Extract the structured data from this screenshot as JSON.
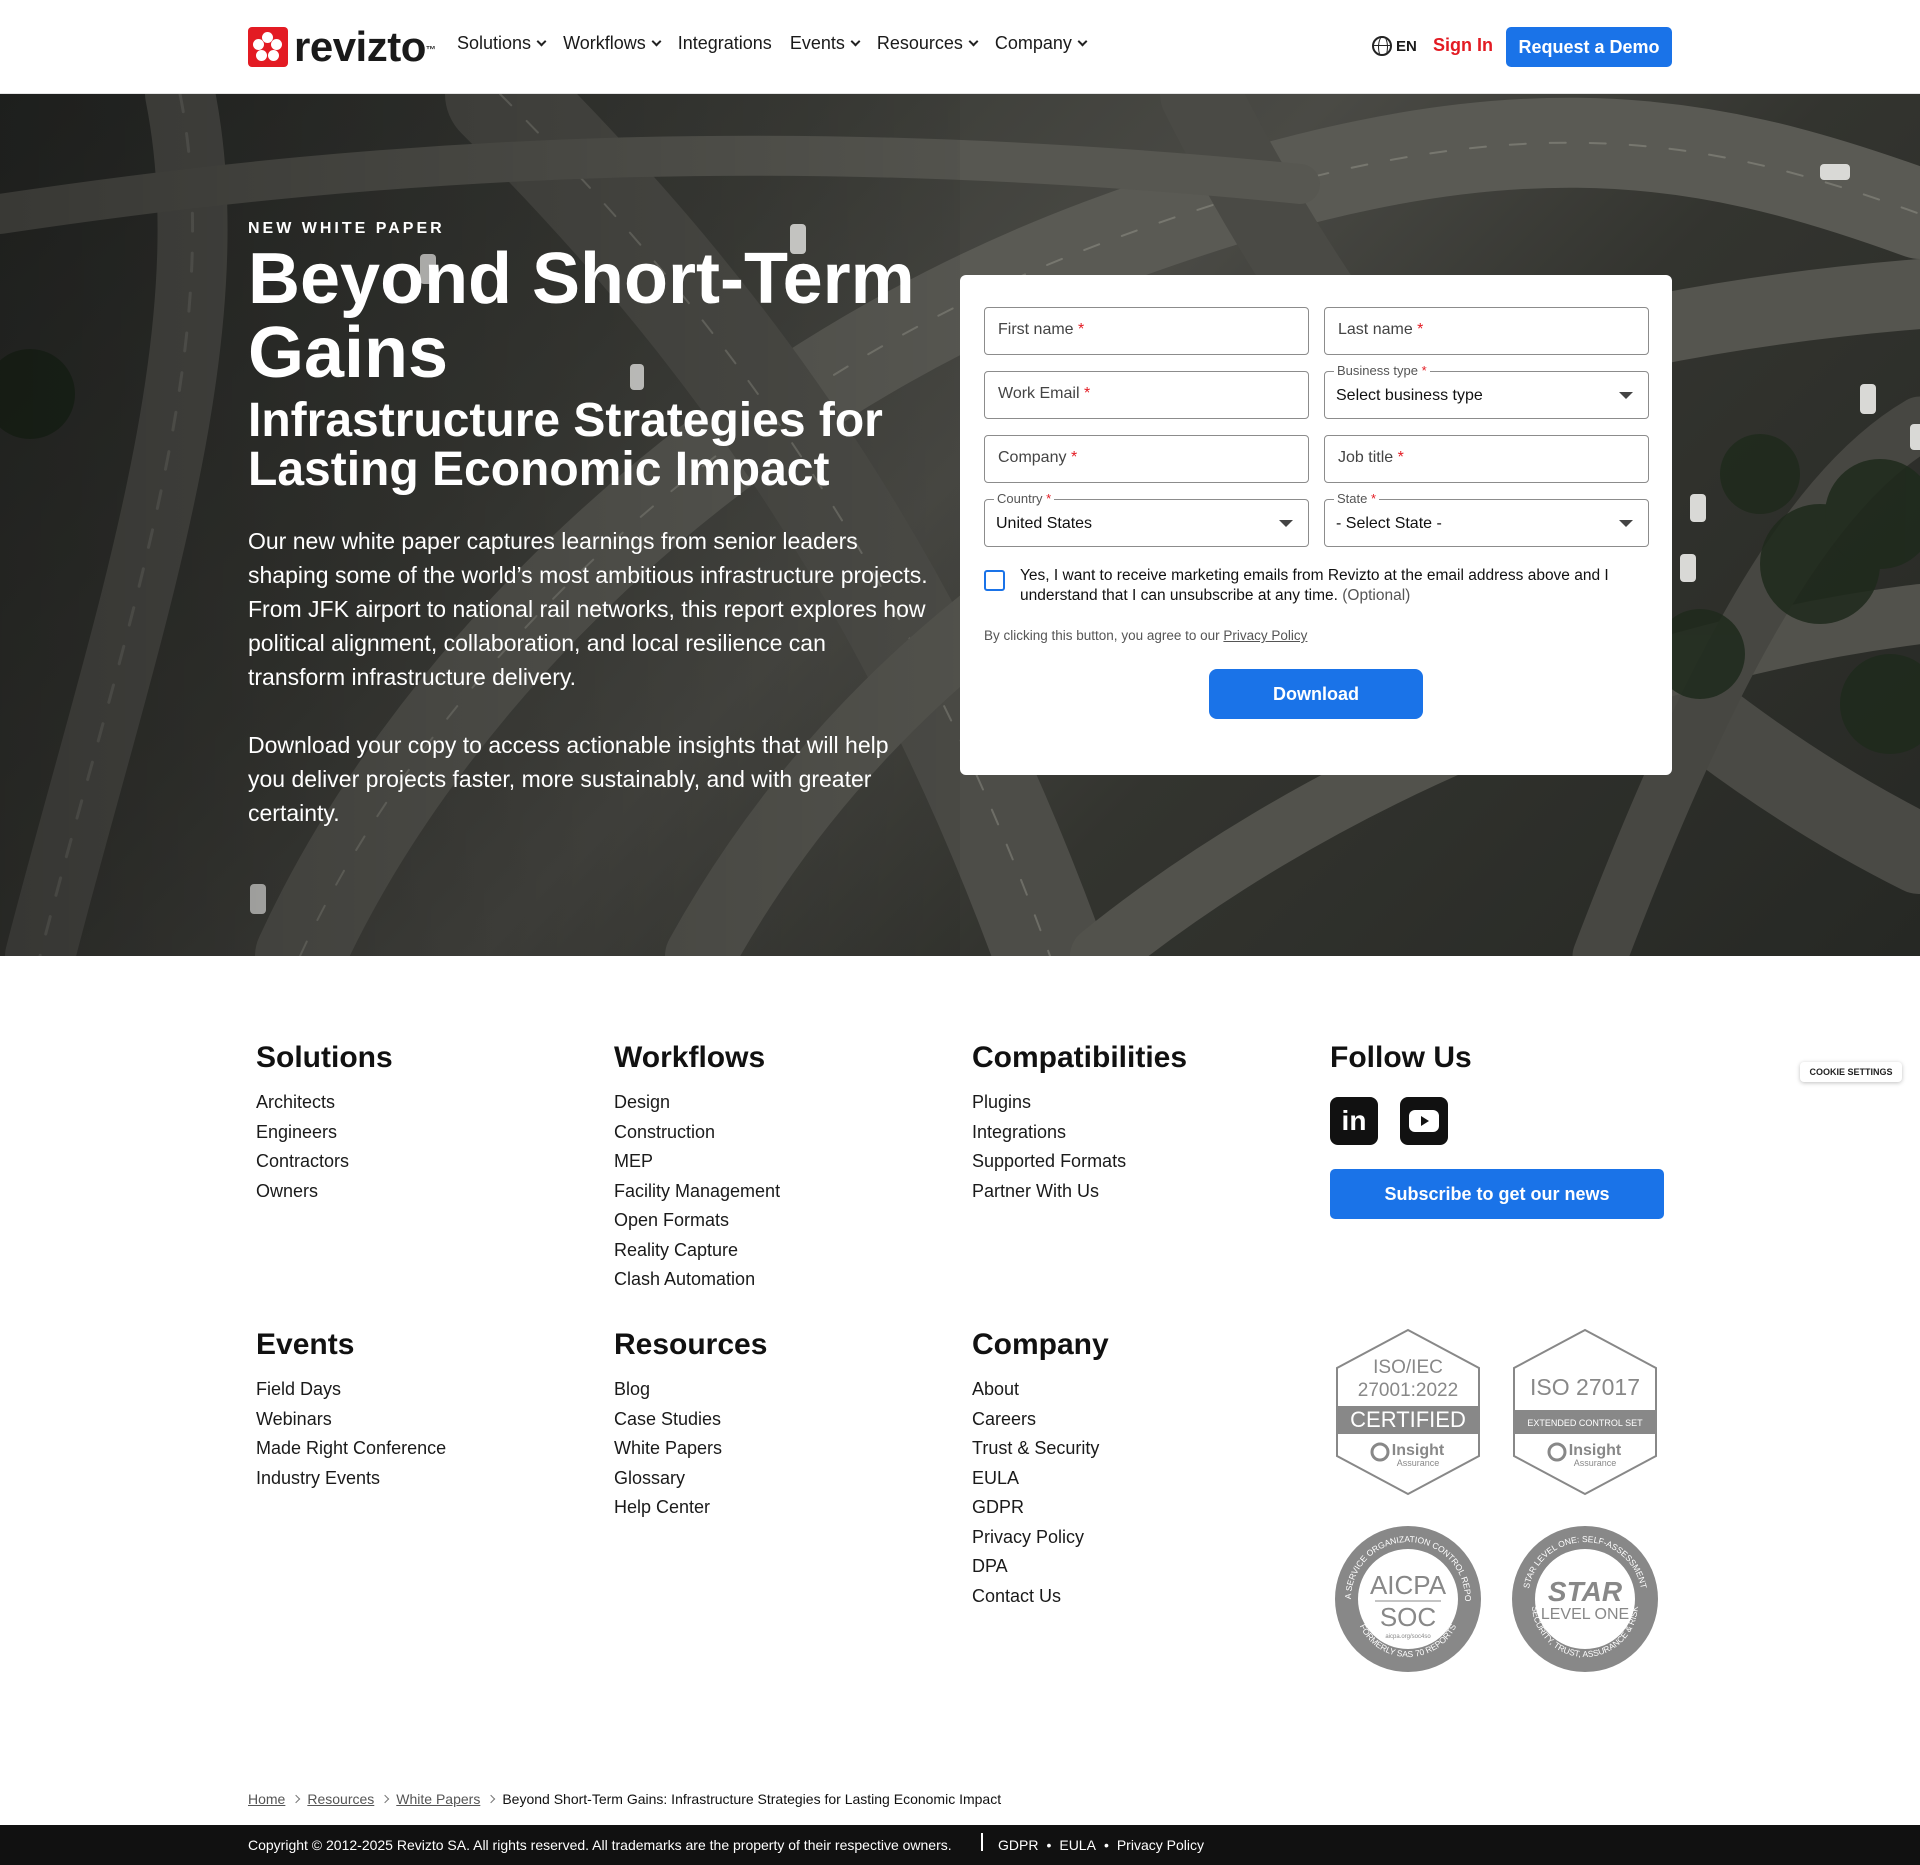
{
  "nav": {
    "logo_text": "revizto",
    "logo_tm": "™",
    "menu": [
      {
        "label": "Solutions",
        "dropdown": true
      },
      {
        "label": "Workflows",
        "dropdown": true
      },
      {
        "label": "Integrations",
        "dropdown": false
      },
      {
        "label": "Events",
        "dropdown": true
      },
      {
        "label": "Resources",
        "dropdown": true
      },
      {
        "label": "Company",
        "dropdown": true
      }
    ],
    "lang": "EN",
    "signin": "Sign In",
    "demo": "Request a Demo"
  },
  "hero": {
    "eyebrow": "NEW WHITE PAPER",
    "title": "Beyond Short-Term Gains",
    "subtitle": "Infrastructure Strategies for Lasting Economic Impact",
    "para1": "Our new white paper captures learnings from senior leaders shaping some of the world’s most ambitious infrastructure projects. From JFK airport to national rail networks, this report explores how political alignment, collaboration, and local resilience can transform infrastructure delivery.",
    "para2": "Download your copy to access actionable insights that will help you deliver projects faster, more sustainably, and with greater certainty."
  },
  "form": {
    "first_name": "First name",
    "last_name": "Last name",
    "work_email": "Work Email",
    "business_type_label": "Business type",
    "business_type_value": "Select business type",
    "company": "Company",
    "job_title": "Job title",
    "country_label": "Country",
    "country_value": "United States",
    "state_label": "State",
    "state_value": "- Select State -",
    "required_mark": "*",
    "consent": "Yes, I want to receive marketing emails from Revizto at the email address above and I understand that I can unsubscribe at any time.",
    "consent_optional": "(Optional)",
    "agree_prefix": "By clicking this button, you agree to our",
    "agree_link": "Privacy Policy",
    "download": "Download"
  },
  "footer": {
    "solutions": {
      "title": "Solutions",
      "links": [
        "Architects",
        "Engineers",
        "Contractors",
        "Owners"
      ]
    },
    "workflows": {
      "title": "Workflows",
      "links": [
        "Design",
        "Construction",
        "MEP",
        "Facility Management",
        "Open Formats",
        "Reality Capture",
        "Clash Automation"
      ]
    },
    "compat": {
      "title": "Compatibilities",
      "links": [
        "Plugins",
        "Integrations",
        "Supported Formats",
        "Partner With Us"
      ]
    },
    "follow": {
      "title": "Follow Us",
      "linkedin_text": "in",
      "subscribe": "Subscribe to get our news"
    },
    "events": {
      "title": "Events",
      "links": [
        "Field Days",
        "Webinars",
        "Made Right Conference",
        "Industry Events"
      ]
    },
    "resources": {
      "title": "Resources",
      "links": [
        "Blog",
        "Case Studies",
        "White Papers",
        "Glossary",
        "Help Center"
      ]
    },
    "company": {
      "title": "Company",
      "links": [
        "About",
        "Careers",
        "Trust & Security",
        "EULA",
        "GDPR",
        "Privacy Policy",
        "DPA",
        "Contact Us"
      ]
    }
  },
  "badges": {
    "iso27001": {
      "line1": "ISO/IEC",
      "line2": "27001:2022",
      "band": "CERTIFIED",
      "brand": "Insight",
      "brand_sub": "Assurance"
    },
    "iso27017": {
      "line1": "ISO 27017",
      "band": "EXTENDED CONTROL SET",
      "brand": "Insight",
      "brand_sub": "Assurance"
    },
    "aicpa": {
      "line1": "AICPA",
      "line2": "SOC",
      "url": "aicpa.org/soc4so",
      "ring_top": "AICPA SERVICE ORGANIZATION CONTROL REPORTS",
      "ring_bottom": "FORMERLY SAS 70 REPORTS"
    },
    "star": {
      "line1": "STAR",
      "line2": "LEVEL ONE",
      "ring_top": "STAR LEVEL ONE: SELF-ASSESSMENT",
      "ring_bottom": "SECURITY, TRUST, ASSURANCE & RISK"
    }
  },
  "cookie": "COOKIE SETTINGS",
  "breadcrumb": {
    "items": [
      "Home",
      "Resources",
      "White Papers"
    ],
    "current": "Beyond Short-Term Gains: Infrastructure Strategies for Lasting Economic Impact"
  },
  "bottom": {
    "copyright": "Copyright © 2012-2025 Revizto SA. All rights reserved. All trademarks are the property of their respective owners.",
    "links": [
      "GDPR",
      "EULA",
      "Privacy Policy"
    ],
    "separator": "•"
  },
  "colors": {
    "brand_red": "#e31b23",
    "accent_blue": "#1a73e8",
    "dark": "#111111"
  }
}
